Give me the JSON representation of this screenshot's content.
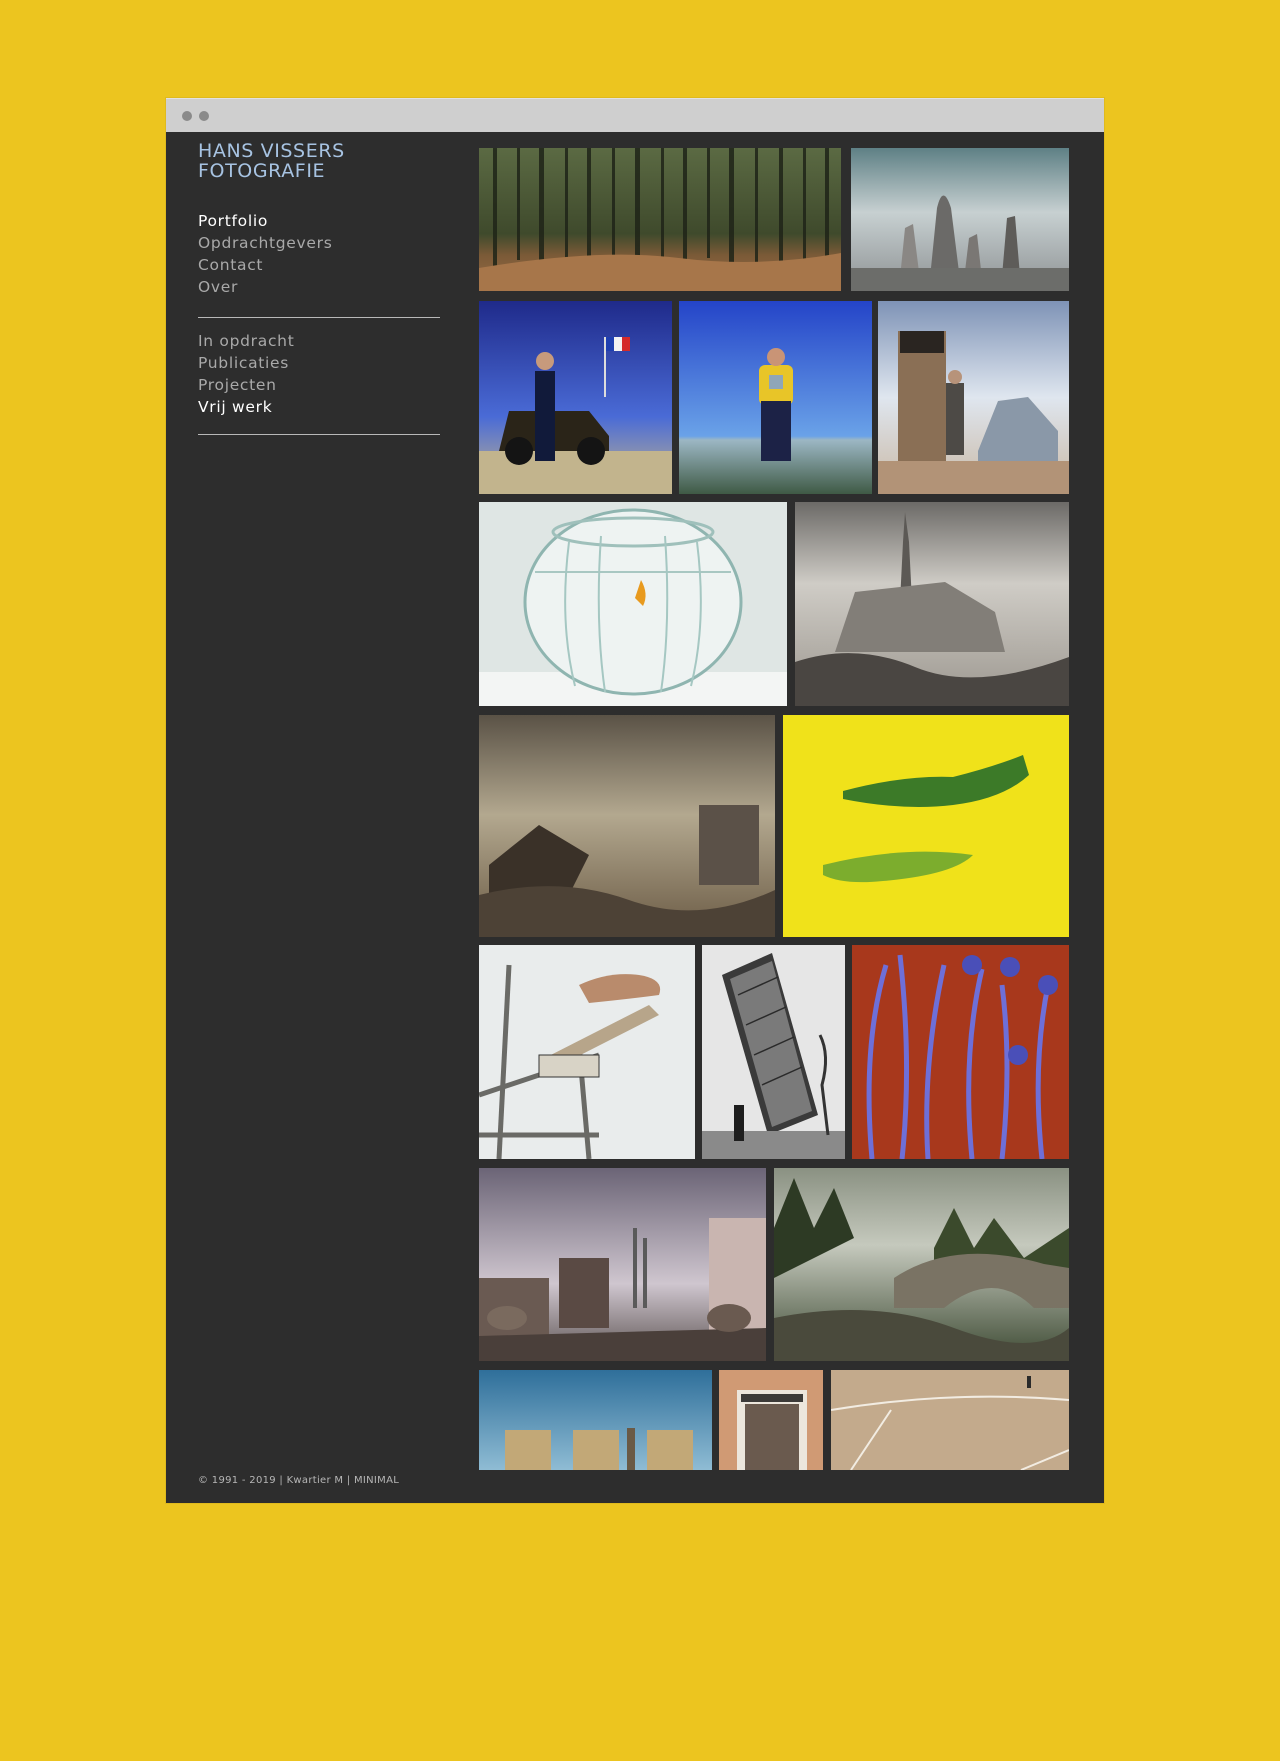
{
  "site": {
    "logo_line1": "HANS VISSERS",
    "logo_line2": "FOTOGRAFIE"
  },
  "nav_primary": [
    {
      "label": "Portfolio",
      "active": true
    },
    {
      "label": "Opdrachtgevers",
      "active": false
    },
    {
      "label": "Contact",
      "active": false
    },
    {
      "label": "Over",
      "active": false
    }
  ],
  "nav_secondary": [
    {
      "label": "In opdracht",
      "active": false
    },
    {
      "label": "Publicaties",
      "active": false
    },
    {
      "label": "Projecten",
      "active": false
    },
    {
      "label": "Vrij werk",
      "active": true
    }
  ],
  "footer": {
    "text": "© 1991 - 2019 | Kwartier M | MINIMAL"
  },
  "colors": {
    "page_background": "#ecc51f",
    "window_background": "#2d2d2d",
    "logo": "#a7c3e2",
    "nav_inactive": "#a9a9a9",
    "nav_active": "#ffffff"
  }
}
